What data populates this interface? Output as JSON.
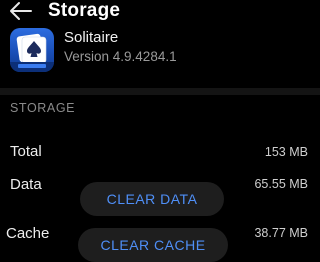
{
  "header": {
    "title": "Storage",
    "back_icon": "arrow-left-icon"
  },
  "app": {
    "name": "Solitaire",
    "version": "Version 4.9.4284.1",
    "icon": "solitaire-app-icon",
    "icon_color": "#2d6de0"
  },
  "storage": {
    "section_label": "STORAGE",
    "rows": [
      {
        "label": "Total",
        "value": "153 MB"
      },
      {
        "label": "Data",
        "value": "65.55 MB"
      },
      {
        "label": "Cache",
        "value": "38.77 MB"
      }
    ],
    "clear_data_label": "CLEAR DATA",
    "clear_cache_label": "CLEAR CACHE"
  },
  "colors": {
    "background": "#000000",
    "accent": "#4f8ff7",
    "button_bg": "#1e1e1e"
  }
}
